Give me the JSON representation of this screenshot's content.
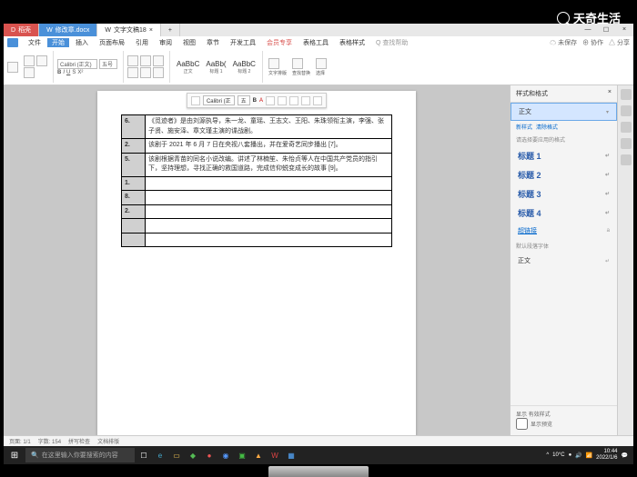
{
  "watermark": "天奇生活",
  "tabs": [
    {
      "label": "稻壳"
    },
    {
      "label": "修改章.docx"
    },
    {
      "label": "文字文稿18"
    }
  ],
  "menu": [
    "文件",
    "开始",
    "插入",
    "页面布局",
    "引用",
    "审阅",
    "视图",
    "章节",
    "开发工具",
    "会员专享",
    "表格工具",
    "表格样式"
  ],
  "menu_extra": "Q 查找帮助",
  "menu_right": {
    "save": "☁ 未保存",
    "coop": "⊕ 协作",
    "share": "△ 分享"
  },
  "ribbon": {
    "font": "Calibri (正文)",
    "size": "五号",
    "styles": [
      {
        "p": "AaBbC",
        "n": "正文"
      },
      {
        "p": "AaBb(",
        "n": "标题 1"
      },
      {
        "p": "AaBbC",
        "n": "标题 2"
      }
    ]
  },
  "float_toolbar": {
    "font": "Calibri (正",
    "size": "五"
  },
  "table": [
    {
      "n": "6.",
      "t": "《觅迹者》是由刘源执导，朱一龙、童瑶、王志文、王阳、朱珠领衔主演，李强、张子贤、施安泽、章文瑾主演的谍战剧。"
    },
    {
      "n": "2.",
      "t": "该剧于 2021 年 6 月 7 日在央视八套播出，并在爱奇艺同步播出 [7]。"
    },
    {
      "n": "5.",
      "t": "该剧根据青苗的同名小说改编。讲述了林楠笙、朱怡贞等人在中国共产党员的指引下，坚持理想，寻找正确的救国道路，完成信仰蜕变成长的故事 [9]。"
    },
    {
      "n": "1.",
      "t": ""
    },
    {
      "n": "8.",
      "t": ""
    },
    {
      "n": "2.",
      "t": ""
    },
    {
      "n": "",
      "t": ""
    },
    {
      "n": "",
      "t": ""
    }
  ],
  "sidepanel": {
    "title": "样式和格式",
    "current": "正文",
    "hint": "请选择要应用的格式",
    "create": "新样式",
    "clear": "清除格式",
    "items": [
      "标题 1",
      "标题 2",
      "标题 3",
      "标题 4",
      "超链接"
    ],
    "defsec": "默认段落字体",
    "defitem": "正文",
    "f1": "显示  有效样式",
    "f2": "显示预览"
  },
  "status": {
    "page": "页面: 1/1",
    "words": "字数: 154",
    "spell": "拼写检查",
    "typeset": "文档排版"
  },
  "taskbar": {
    "search": "在这里输入你要搜索的内容",
    "temp": "10°C",
    "time": "10:44",
    "date": "2022/1/6"
  }
}
